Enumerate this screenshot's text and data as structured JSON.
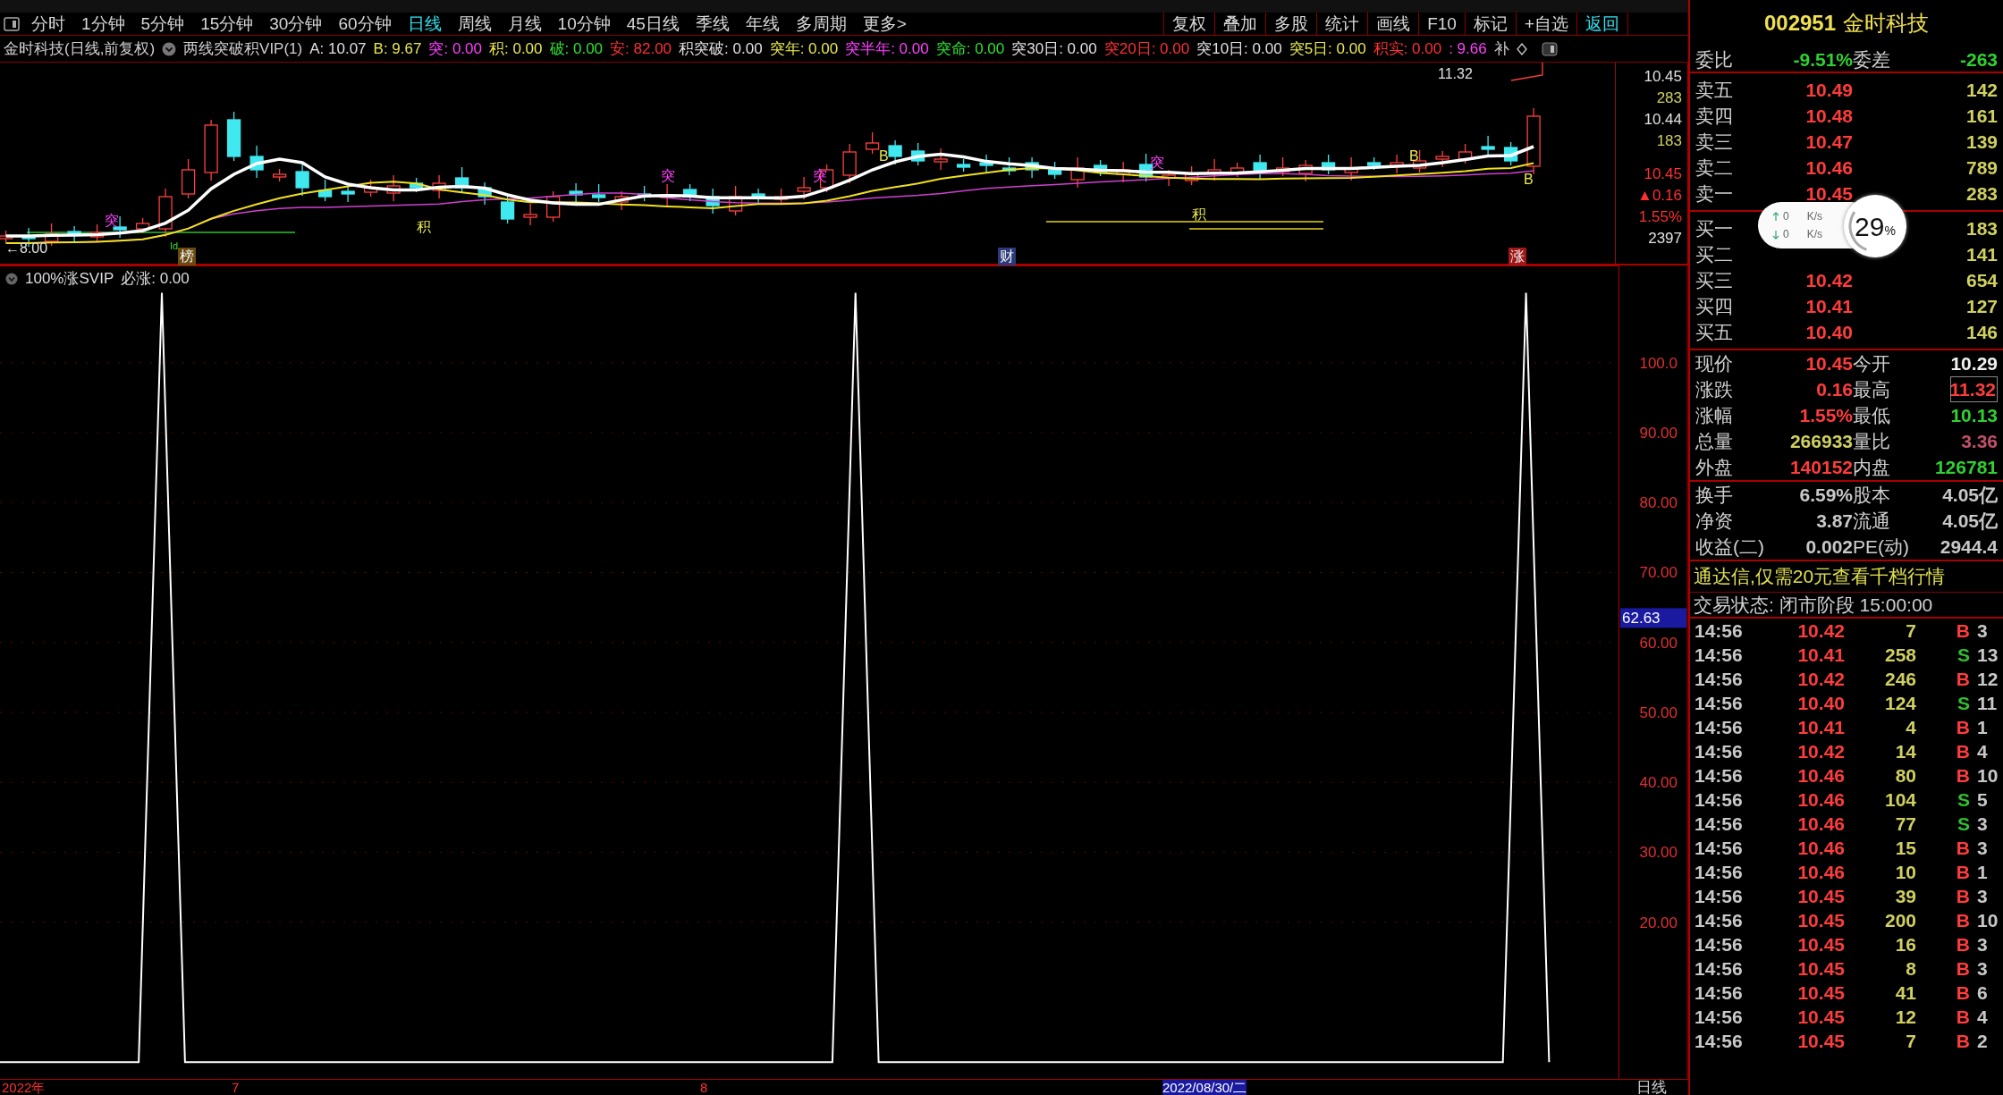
{
  "toolbar": {
    "periods": [
      {
        "label": "分时",
        "selected": false
      },
      {
        "label": "1分钟",
        "selected": false
      },
      {
        "label": "5分钟",
        "selected": false
      },
      {
        "label": "15分钟",
        "selected": false
      },
      {
        "label": "30分钟",
        "selected": false
      },
      {
        "label": "60分钟",
        "selected": false
      },
      {
        "label": "日线",
        "selected": true
      },
      {
        "label": "周线",
        "selected": false
      },
      {
        "label": "月线",
        "selected": false
      },
      {
        "label": "10分钟",
        "selected": false
      },
      {
        "label": "45日线",
        "selected": false
      },
      {
        "label": "季线",
        "selected": false
      },
      {
        "label": "年线",
        "selected": false
      },
      {
        "label": "多周期",
        "selected": false
      },
      {
        "label": "更多>",
        "selected": false
      }
    ],
    "actions": [
      {
        "label": "复权",
        "selected": false
      },
      {
        "label": "叠加",
        "selected": false
      },
      {
        "label": "多股",
        "selected": false
      },
      {
        "label": "统计",
        "selected": false
      },
      {
        "label": "画线",
        "selected": false
      },
      {
        "label": "F10",
        "selected": false
      },
      {
        "label": "标记",
        "selected": false
      },
      {
        "label": "+自选",
        "selected": false
      },
      {
        "label": "返回",
        "selected": true
      }
    ]
  },
  "indicator_bar": {
    "stock": "金时科技(日线,前复权)",
    "formula": "两线突破积VIP(1)",
    "values": [
      {
        "label": "A:",
        "value": "10.07",
        "color": "#e0e0e0"
      },
      {
        "label": "B:",
        "value": "9.67",
        "color": "#e8e850"
      },
      {
        "label": "突:",
        "value": "0.00",
        "color": "#ff40ff"
      },
      {
        "label": "积:",
        "value": "0.00",
        "color": "#e8e850"
      },
      {
        "label": "破:",
        "value": "0.00",
        "color": "#30e030"
      },
      {
        "label": "安:",
        "value": "82.00",
        "color": "#ff3030"
      },
      {
        "label": "积突破:",
        "value": "0.00",
        "color": "#e0e0e0"
      },
      {
        "label": "突年:",
        "value": "0.00",
        "color": "#e8e850"
      },
      {
        "label": "突半年:",
        "value": "0.00",
        "color": "#ff40ff"
      },
      {
        "label": "突命:",
        "value": "0.00",
        "color": "#30e030"
      },
      {
        "label": "突30日:",
        "value": "0.00",
        "color": "#e0e0e0"
      },
      {
        "label": "突20日:",
        "value": "0.00",
        "color": "#ff3030"
      },
      {
        "label": "突10日:",
        "value": "0.00",
        "color": "#e0e0e0"
      },
      {
        "label": "突5日:",
        "value": "0.00",
        "color": "#e8e850"
      },
      {
        "label": "积实:",
        "value": "0.00",
        "color": "#ff3030"
      },
      {
        "label": ":",
        "value": "9.66",
        "color": "#ff40ff"
      }
    ],
    "cut_label": "补"
  },
  "chart_marks": [
    {
      "text": "←8.00",
      "kind": "label",
      "color": "#e0e0e0"
    },
    {
      "text": "Id",
      "kind": "label",
      "color": "#30e030"
    },
    {
      "text": "榜",
      "kind": "tag",
      "color": "#6a4a10"
    },
    {
      "text": "财",
      "kind": "tag",
      "color": "#2a3a7a"
    },
    {
      "text": "涨",
      "kind": "tag",
      "color": "#a01818"
    },
    {
      "text": "突",
      "kind": "label",
      "color": "#ff40ff"
    },
    {
      "text": "突",
      "kind": "label",
      "color": "#ff40ff"
    },
    {
      "text": "突",
      "kind": "label",
      "color": "#ff40ff"
    },
    {
      "text": "突",
      "kind": "label",
      "color": "#ff40ff"
    },
    {
      "text": "积",
      "kind": "label",
      "color": "#e8e850"
    },
    {
      "text": "积",
      "kind": "label",
      "color": "#e8e850"
    },
    {
      "text": "B",
      "kind": "label",
      "color": "#e8e850"
    },
    {
      "text": "B",
      "kind": "label",
      "color": "#e8e850"
    },
    {
      "text": "B",
      "kind": "label",
      "color": "#e8e850"
    },
    {
      "text": "11.32",
      "kind": "label",
      "color": "#e0e0e0"
    }
  ],
  "price_axis": {
    "upper": [
      {
        "text": "10.45",
        "color": "#e0e0e0"
      },
      {
        "text": "283",
        "color": "#d0d060"
      },
      {
        "text": "10.44",
        "color": "#e0e0e0"
      },
      {
        "text": "183",
        "color": "#d0d060"
      }
    ],
    "lower": [
      {
        "text": "10.45",
        "color": "#ff3030"
      },
      {
        "text": "▲0.16",
        "color": "#ff3030"
      },
      {
        "text": "1.55%",
        "color": "#ff3030"
      },
      {
        "text": "2397",
        "color": "#e0e0e0"
      }
    ]
  },
  "lower_panel": {
    "title": "100%涨SVIP",
    "reading": ": 0.00",
    "cursor_value": "62.63",
    "chart_data": {
      "type": "line",
      "grid": true,
      "ylim": [
        -2.4,
        113.9
      ],
      "yticks": [
        {
          "value": 20,
          "label": "20.00"
        },
        {
          "value": 30,
          "label": "30.00"
        },
        {
          "value": 40,
          "label": "40.00"
        },
        {
          "value": 50,
          "label": "50.00"
        },
        {
          "value": 60,
          "label": "60.00"
        },
        {
          "value": 70,
          "label": "70.00"
        },
        {
          "value": 80,
          "label": "80.00"
        },
        {
          "value": 90,
          "label": "90.00"
        },
        {
          "value": 100,
          "label": "100.0"
        }
      ],
      "series": [
        {
          "name": "必涨",
          "color": "#ffffff",
          "values": [
            0,
            0,
            0,
            0,
            0,
            0,
            0,
            110,
            0,
            0,
            0,
            0,
            0,
            0,
            0,
            0,
            0,
            0,
            0,
            0,
            0,
            0,
            0,
            0,
            0,
            0,
            0,
            0,
            0,
            0,
            0,
            0,
            0,
            0,
            0,
            0,
            0,
            110,
            0,
            0,
            0,
            0,
            0,
            0,
            0,
            0,
            0,
            0,
            0,
            0,
            0,
            0,
            0,
            0,
            0,
            0,
            0,
            0,
            0,
            0,
            0,
            0,
            0,
            0,
            0,
            0,
            110,
            0,
            null,
            null,
            null
          ]
        }
      ]
    }
  },
  "date_axis": [
    {
      "text": "2022年",
      "selected": false
    },
    {
      "text": "7",
      "selected": false
    },
    {
      "text": "8",
      "selected": false
    },
    {
      "text": "2022/08/30/二",
      "selected": true
    }
  ],
  "period_label": "日线",
  "quote_panel": {
    "code": "002951",
    "name": "金时科技",
    "ratio": {
      "label": "委比",
      "value": "-9.51%",
      "label2": "委差",
      "value2": "-263"
    },
    "sells": [
      {
        "label": "卖五",
        "price": "10.49",
        "volume": "142"
      },
      {
        "label": "卖四",
        "price": "10.48",
        "volume": "161"
      },
      {
        "label": "卖三",
        "price": "10.47",
        "volume": "139"
      },
      {
        "label": "卖二",
        "price": "10.46",
        "volume": "789"
      },
      {
        "label": "卖一",
        "price": "10.45",
        "volume": "283"
      }
    ],
    "buys": [
      {
        "label": "买一",
        "volume": "183"
      },
      {
        "label": "买二",
        "volume": "141"
      },
      {
        "label": "买三",
        "price": "10.42",
        "volume": "654"
      },
      {
        "label": "买四",
        "price": "10.41",
        "volume": "127"
      },
      {
        "label": "买五",
        "price": "10.40",
        "volume": "146"
      }
    ],
    "quotes": [
      {
        "left": {
          "label": "现价",
          "value": "10.45",
          "color": "#ff3c3c"
        },
        "right": {
          "label": "今开",
          "value": "10.29",
          "color": "#f0f0f0",
          "boxed": false
        }
      },
      {
        "left": {
          "label": "涨跌",
          "value": "0.16",
          "color": "#ff3c3c"
        },
        "right": {
          "label": "最高",
          "value": "11.32",
          "color": "#ff3c3c",
          "boxed": true
        }
      },
      {
        "left": {
          "label": "涨幅",
          "value": "1.55%",
          "color": "#ff3c3c"
        },
        "right": {
          "label": "最低",
          "value": "10.13",
          "color": "#30d030",
          "boxed": false
        }
      },
      {
        "left": {
          "label": "总量",
          "value": "266933",
          "color": "#d0d060"
        },
        "right": {
          "label": "量比",
          "value": "3.36",
          "color": "#c05068",
          "boxed": false
        }
      },
      {
        "left": {
          "label": "外盘",
          "value": "140152",
          "color": "#ff3c3c"
        },
        "right": {
          "label": "内盘",
          "value": "126781",
          "color": "#30d030",
          "boxed": false
        }
      }
    ],
    "stats": [
      {
        "label": "换手",
        "value": "6.59%",
        "label2": "股本",
        "value2": "4.05亿"
      },
      {
        "label": "净资",
        "value": "3.87",
        "label2": "流通",
        "value2": "4.05亿"
      },
      {
        "label": "收益(二)",
        "value": "0.002",
        "label2": "PE(动)",
        "value2": "2944.4"
      }
    ],
    "promo": "通达信,仅需20元查看千档行情",
    "status": "交易状态: 闭市阶段 15:00:00",
    "ticks": [
      {
        "time": "14:56",
        "price": "10.42",
        "volume": "7",
        "side": {
          "text": "B",
          "color": "#ff3c3c"
        },
        "count": "3"
      },
      {
        "time": "14:56",
        "price": "10.41",
        "volume": "258",
        "side": {
          "text": "S",
          "color": "#30c030"
        },
        "count": "13"
      },
      {
        "time": "14:56",
        "price": "10.42",
        "volume": "246",
        "side": {
          "text": "B",
          "color": "#ff3c3c"
        },
        "count": "12"
      },
      {
        "time": "14:56",
        "price": "10.40",
        "volume": "124",
        "side": {
          "text": "S",
          "color": "#30c030"
        },
        "count": "11"
      },
      {
        "time": "14:56",
        "price": "10.41",
        "volume": "4",
        "side": {
          "text": "B",
          "color": "#ff3c3c"
        },
        "count": "1"
      },
      {
        "time": "14:56",
        "price": "10.42",
        "volume": "14",
        "side": {
          "text": "B",
          "color": "#ff3c3c"
        },
        "count": "4"
      },
      {
        "time": "14:56",
        "price": "10.46",
        "volume": "80",
        "side": {
          "text": "B",
          "color": "#ff3c3c"
        },
        "count": "10"
      },
      {
        "time": "14:56",
        "price": "10.46",
        "volume": "104",
        "side": {
          "text": "S",
          "color": "#30c030"
        },
        "count": "5"
      },
      {
        "time": "14:56",
        "price": "10.46",
        "volume": "77",
        "side": {
          "text": "S",
          "color": "#30c030"
        },
        "count": "3"
      },
      {
        "time": "14:56",
        "price": "10.46",
        "volume": "15",
        "side": {
          "text": "B",
          "color": "#ff3c3c"
        },
        "count": "3"
      },
      {
        "time": "14:56",
        "price": "10.46",
        "volume": "10",
        "side": {
          "text": "B",
          "color": "#ff3c3c"
        },
        "count": "1"
      },
      {
        "time": "14:56",
        "price": "10.45",
        "volume": "39",
        "side": {
          "text": "B",
          "color": "#ff3c3c"
        },
        "count": "3"
      },
      {
        "time": "14:56",
        "price": "10.45",
        "volume": "200",
        "side": {
          "text": "B",
          "color": "#ff3c3c"
        },
        "count": "10"
      },
      {
        "time": "14:56",
        "price": "10.45",
        "volume": "16",
        "side": {
          "text": "B",
          "color": "#ff3c3c"
        },
        "count": "3"
      },
      {
        "time": "14:56",
        "price": "10.45",
        "volume": "8",
        "side": {
          "text": "B",
          "color": "#ff3c3c"
        },
        "count": "3"
      },
      {
        "time": "14:56",
        "price": "10.45",
        "volume": "41",
        "side": {
          "text": "B",
          "color": "#ff3c3c"
        },
        "count": "6"
      },
      {
        "time": "14:56",
        "price": "10.45",
        "volume": "12",
        "side": {
          "text": "B",
          "color": "#ff3c3c"
        },
        "count": "4"
      },
      {
        "time": "14:56",
        "price": "10.45",
        "volume": "7",
        "side": {
          "text": "B",
          "color": "#ff3c3c"
        },
        "count": "2"
      }
    ]
  },
  "speed_widget": {
    "upload": "0",
    "upload_unit": "K/s",
    "download": "0",
    "download_unit": "K/s",
    "percent": "29",
    "percent_sign": "%",
    "level": 0.29
  }
}
